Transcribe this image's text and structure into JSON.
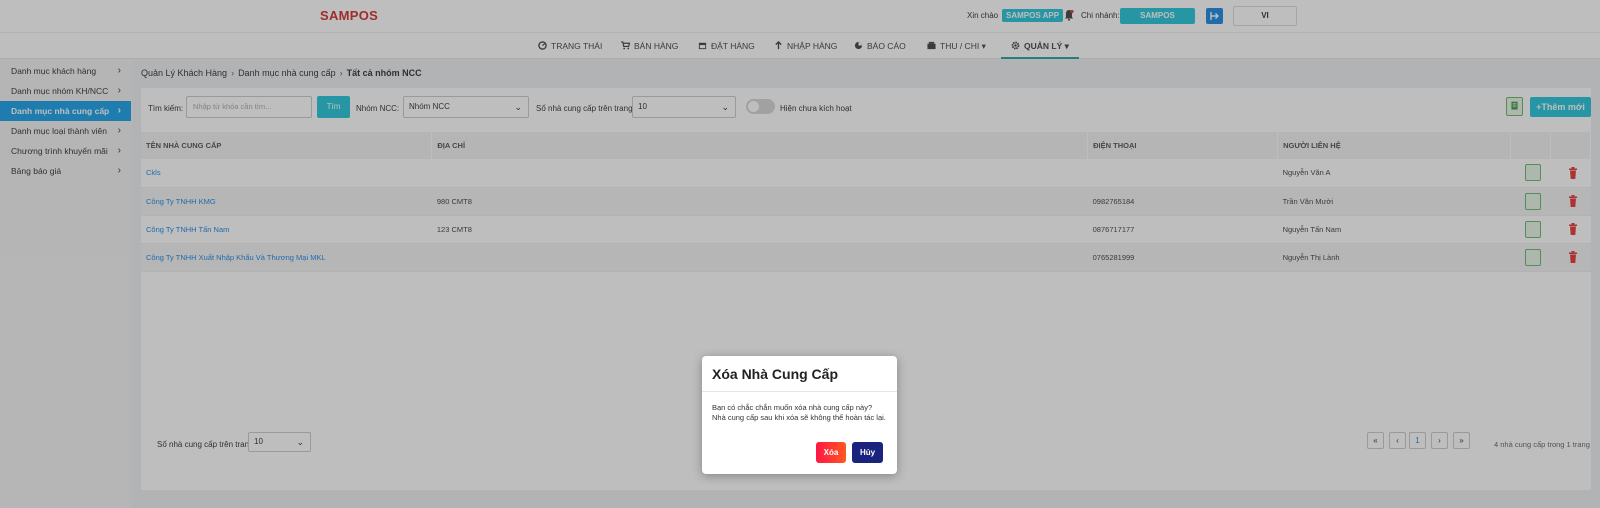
{
  "header": {
    "logo": "SAMPOS",
    "greeting": "Xin chào",
    "user_badge": "SAMPOS APP",
    "branch_label": "Chi nhánh:",
    "branch_value": "SAMPOS",
    "language": "VI"
  },
  "nav": {
    "items": [
      {
        "label": "TRẠNG THÁI",
        "icon": "dashboard-icon"
      },
      {
        "label": "BÁN HÀNG",
        "icon": "cart-icon"
      },
      {
        "label": "ĐẶT HÀNG",
        "icon": "calendar-icon"
      },
      {
        "label": "NHẬP HÀNG",
        "icon": "arrow-up-icon"
      },
      {
        "label": "BÁO CÁO",
        "icon": "pie-chart-icon"
      },
      {
        "label": "THU / CHI",
        "icon": "cash-register-icon"
      },
      {
        "label": "QUẢN LÝ",
        "icon": "gear-icon"
      }
    ]
  },
  "sidebar": {
    "items": [
      {
        "label": "Danh mục khách hàng"
      },
      {
        "label": "Danh mục nhóm KH/NCC"
      },
      {
        "label": "Danh mục nhà cung cấp"
      },
      {
        "label": "Danh mục loại thành viên"
      },
      {
        "label": "Chương trình khuyến mãi"
      },
      {
        "label": "Bảng báo giá"
      }
    ]
  },
  "breadcrumb": {
    "items": [
      "Quản Lý Khách Hàng",
      "Danh mục nhà cung cấp",
      "Tất cả nhóm NCC"
    ]
  },
  "filters": {
    "search_label": "Tìm kiếm:",
    "search_placeholder": "Nhập từ khóa cần tìm...",
    "search_button": "Tìm",
    "group_label": "Nhóm NCC:",
    "group_value": "Nhóm NCC",
    "per_page_label": "Số nhà cung cấp trên trang:",
    "per_page_value": "10",
    "inactive_toggle_label": "Hiện chưa kích hoạt",
    "add_button": "+Thêm mới"
  },
  "table": {
    "columns": [
      "TÊN NHÀ CUNG CẤP",
      "ĐỊA CHỈ",
      "ĐIỆN THOẠI",
      "NGƯỜI LIÊN HỆ"
    ],
    "rows": [
      {
        "name": "Ckls",
        "address": "",
        "phone": "",
        "contact": "Nguyễn Văn A"
      },
      {
        "name": "Công Ty TNHH KMG",
        "address": "980 CMT8",
        "phone": "0982765184",
        "contact": "Trần Văn Mười"
      },
      {
        "name": "Công Ty TNHH Tấn Nam",
        "address": "123 CMT8",
        "phone": "0876717177",
        "contact": "Nguyễn Tấn Nam"
      },
      {
        "name": "Công Ty TNHH Xuất Nhập Khẩu Và Thương Mại MKL",
        "address": "",
        "phone": "0765281999",
        "contact": "Nguyễn Thị Lành"
      }
    ]
  },
  "footer": {
    "per_page_label": "Số nhà cung cấp trên trang:",
    "per_page_value": "10",
    "pager": {
      "first": "«",
      "prev": "‹",
      "current": "1",
      "next": "›",
      "last": "»"
    },
    "info": "4 nhà cung cấp trong 1 trang"
  },
  "modal": {
    "title": "Xóa Nhà Cung Cấp",
    "line1": "Bạn có chắc chắn muốn xóa nhà cung cấp này?",
    "line2": "Nhà cung cấp sau khi xóa sẽ không thể hoàn tác lại.",
    "delete_button": "Xóa",
    "cancel_button": "Hủy"
  },
  "colors": {
    "accent": "#26c6da",
    "logo": "#d32f2f",
    "sidebar_active": "#1aa3e8",
    "danger": "#ff1744",
    "cancel": "#1a237e"
  }
}
